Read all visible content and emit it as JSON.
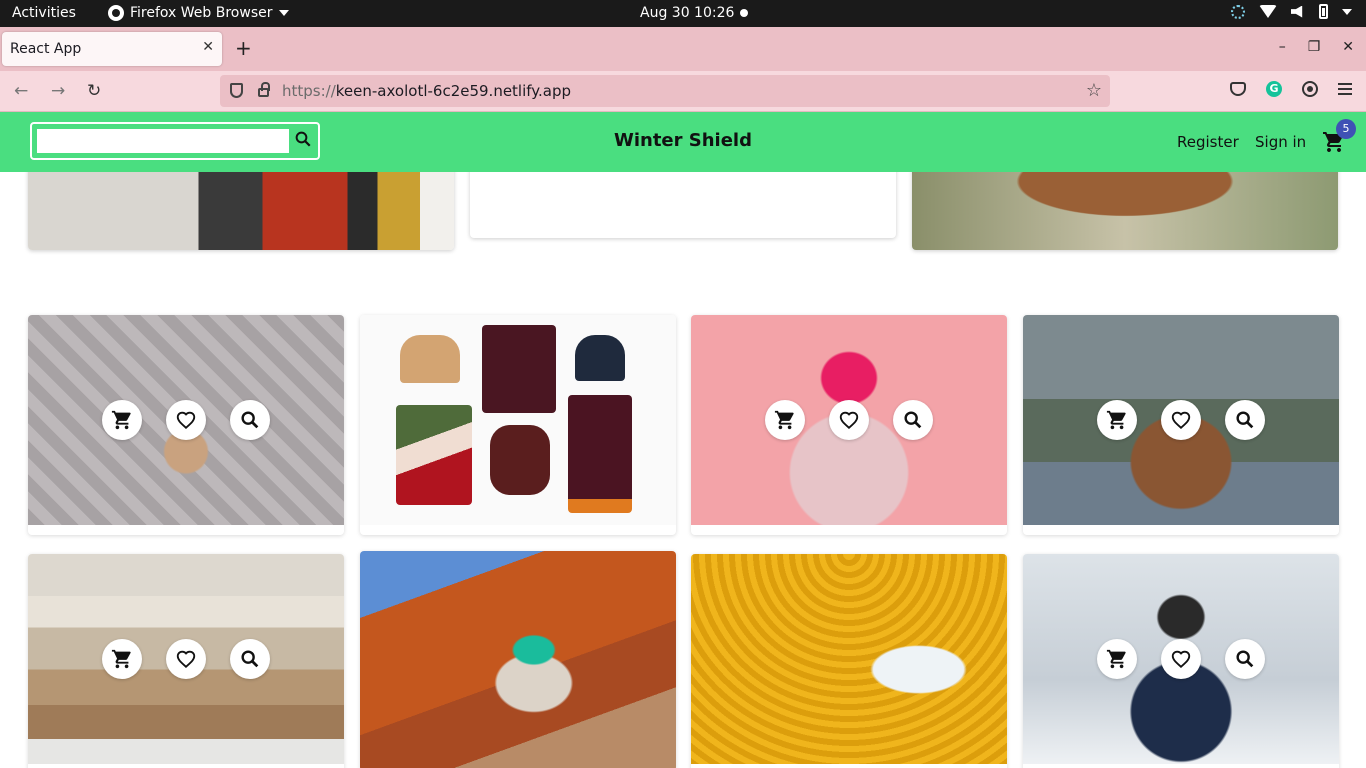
{
  "system": {
    "activities": "Activities",
    "app_name": "Firefox Web Browser",
    "clock": "Aug 30  10:26"
  },
  "browser": {
    "tab_title": "React App",
    "url_scheme": "https://",
    "url_host": "keen-axolotl-6c2e59.netlify.app",
    "window_controls": [
      "–",
      "❐",
      "✕"
    ]
  },
  "site": {
    "brand": "Winter Shield",
    "search_placeholder": "",
    "nav": {
      "register": "Register",
      "sign_in": "Sign in"
    },
    "cart_count": "5",
    "accent_color": "#4ade80",
    "badge_color": "#3f51b5"
  },
  "products": [
    {
      "image": "knit-blanket-book",
      "actions": true
    },
    {
      "image": "winter-flat-lay",
      "actions": false
    },
    {
      "image": "girl-pink-beanie",
      "actions": true
    },
    {
      "image": "woman-brown-coat-phone",
      "actions": true
    },
    {
      "image": "folded-sweaters",
      "actions": true
    },
    {
      "image": "woman-green-scarf-autumn",
      "actions": false
    },
    {
      "image": "yellow-sweater-tag",
      "actions": false
    },
    {
      "image": "girl-snow-trapper-hat",
      "actions": true
    }
  ],
  "icons": {
    "cart": "cart-icon",
    "wishlist": "heart-icon",
    "zoom": "search-icon"
  }
}
